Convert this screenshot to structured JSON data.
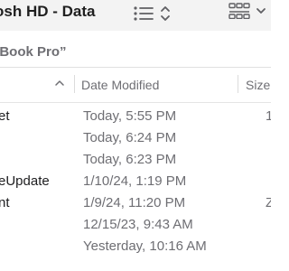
{
  "toolbar": {
    "title": "osh HD - Data",
    "list_view_icon": "list-view-icon",
    "view_options_icon": "chevron-up-down-icon",
    "group_icon": "icon-grid-group-icon",
    "group_chevron_icon": "chevron-down-icon"
  },
  "path_bar": {
    "title": "cBook Pro”"
  },
  "columns": {
    "name_sort_icon": "chevron-up-icon",
    "date_modified": "Date Modified",
    "size": "Size"
  },
  "files": [
    {
      "name": "et",
      "date_modified": "Today, 5:55 PM",
      "size": "1"
    },
    {
      "name": "",
      "date_modified": "Today, 6:24 PM",
      "size": ""
    },
    {
      "name": "",
      "date_modified": "Today, 6:23 PM",
      "size": ""
    },
    {
      "name": "eUpdate",
      "date_modified": "1/10/24, 1:19 PM",
      "size": ""
    },
    {
      "name": "nt",
      "date_modified": "1/9/24, 11:20 PM",
      "size": "Z"
    },
    {
      "name": "",
      "date_modified": "12/15/23, 9:43 AM",
      "size": ""
    },
    {
      "name": "",
      "date_modified": "Yesterday, 10:16 AM",
      "size": ""
    }
  ],
  "colors": {
    "toolbar_bg": "#f3f3f3",
    "text_primary": "#1d1d1f",
    "text_secondary": "#6e6e73"
  }
}
